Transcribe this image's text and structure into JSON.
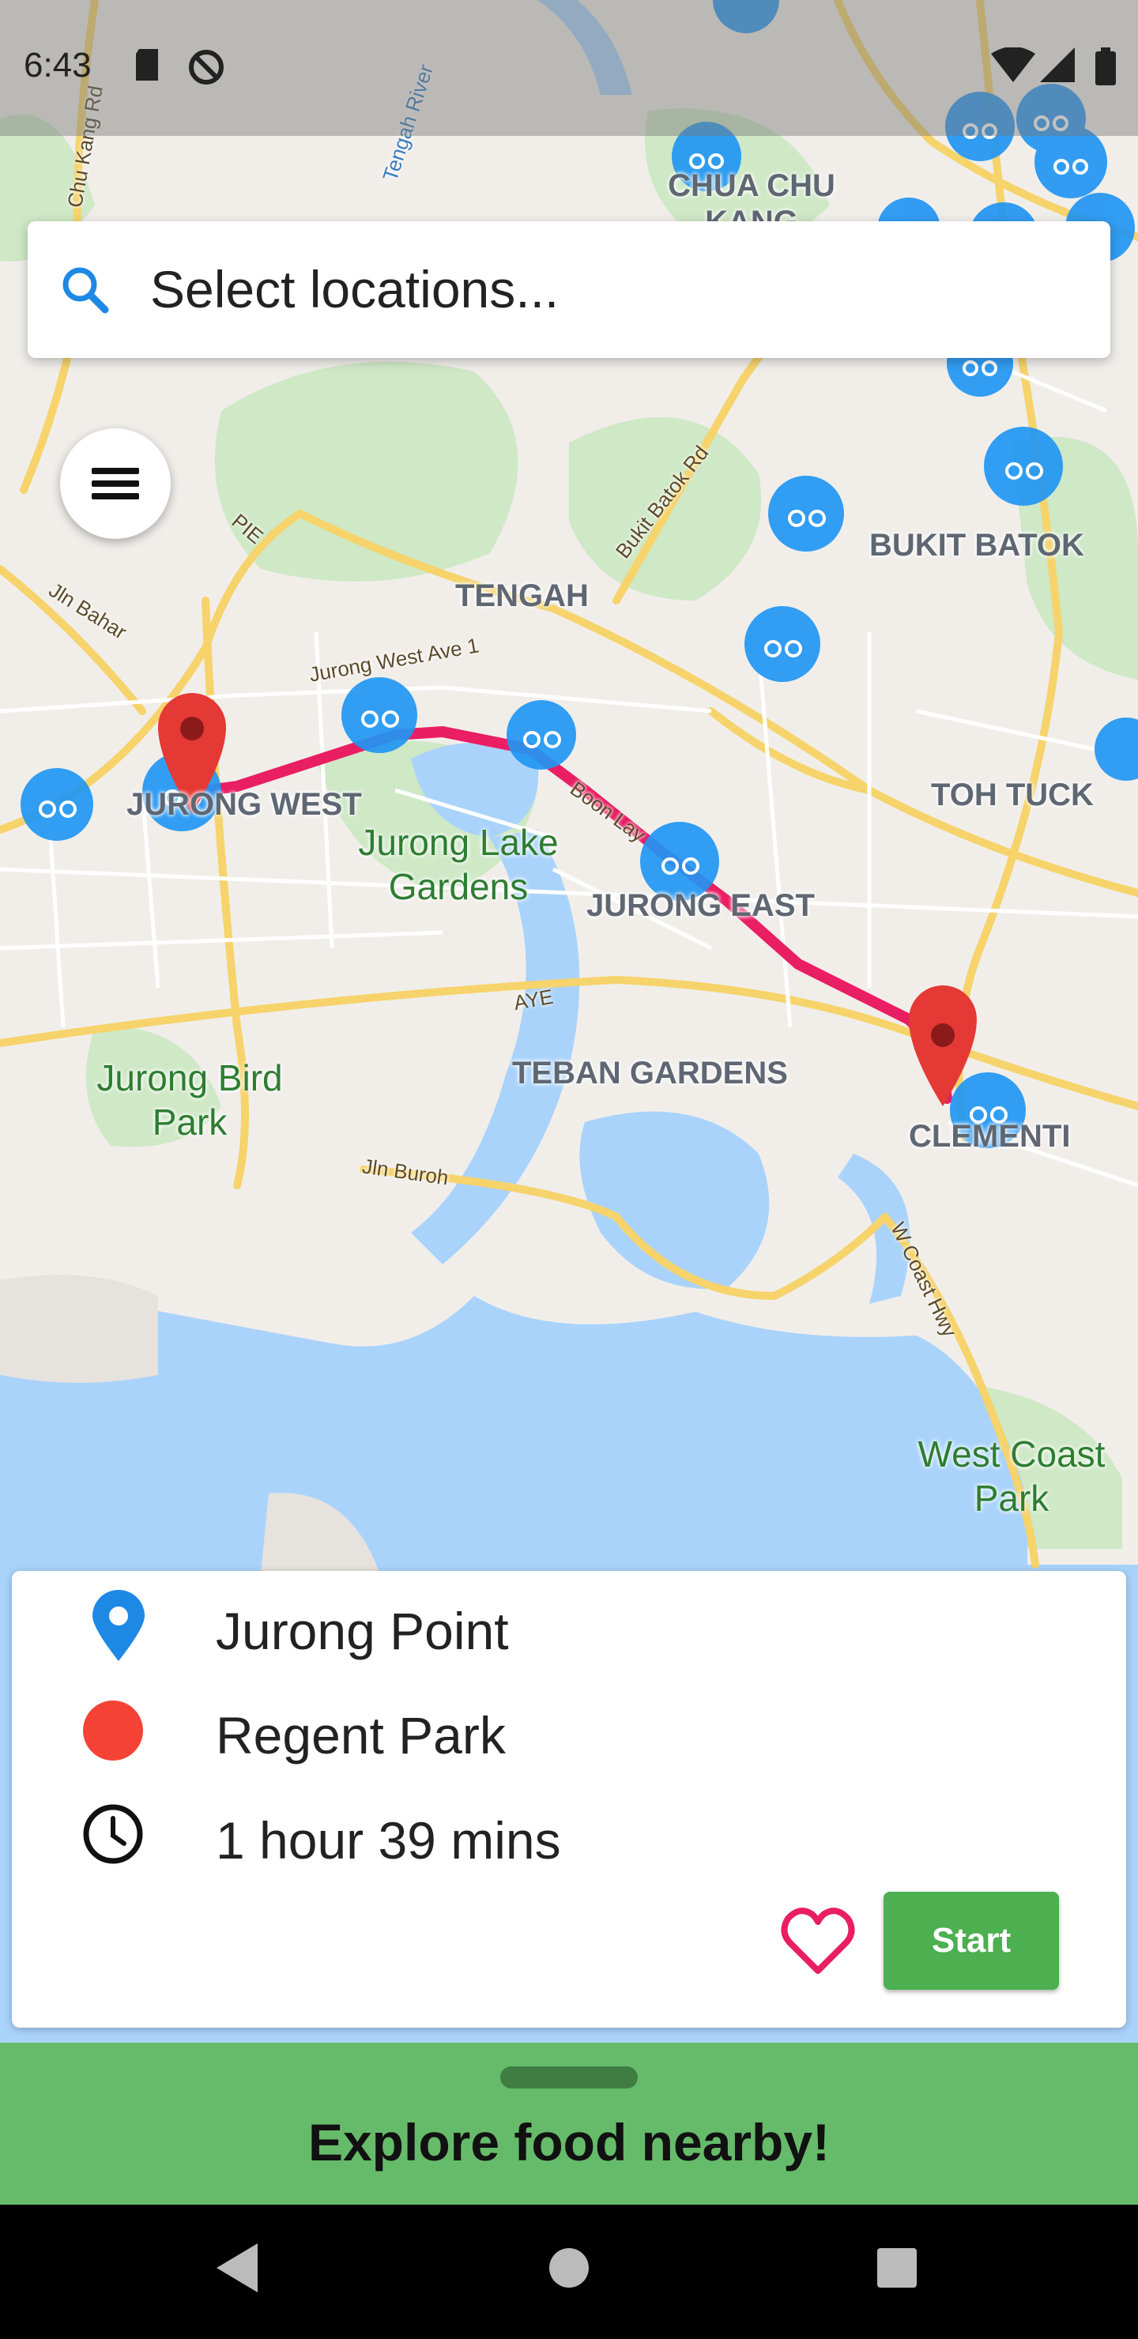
{
  "status_bar": {
    "time": "6:43",
    "icons": [
      "sd-card-icon",
      "do-not-disturb-icon",
      "wifi-icon",
      "cell-signal-icon",
      "battery-icon"
    ]
  },
  "search": {
    "placeholder": "Select locations..."
  },
  "map": {
    "areas": [
      "CHUA CHU KANG",
      "TENGAH",
      "BUKIT BATOK",
      "TOH TUCK",
      "JURONG WEST",
      "JURONG EAST",
      "TEBAN GARDENS",
      "CLEMENTI"
    ],
    "parks": [
      "Jurong Lake Gardens",
      "Jurong Bird Park",
      "West Coast Park"
    ],
    "roads": [
      "Jln Bahar",
      "PIE",
      "Bukit Batok Rd",
      "Jurong West Ave 1",
      "Boon Lay",
      "AYE",
      "Jln Buroh",
      "W Coast Hwy",
      "Tengah River",
      "Chu Kang Rd"
    ],
    "route_color": "#e91e63",
    "bike_marker_color": "#2196f3",
    "pin_color": "#e53935"
  },
  "route_card": {
    "origin": "Jurong Point",
    "destination": "Regent Park",
    "duration": "1 hour 39 mins",
    "start_label": "Start",
    "accent": "#4caf50"
  },
  "bottom_sheet": {
    "title": "Explore food nearby!"
  }
}
